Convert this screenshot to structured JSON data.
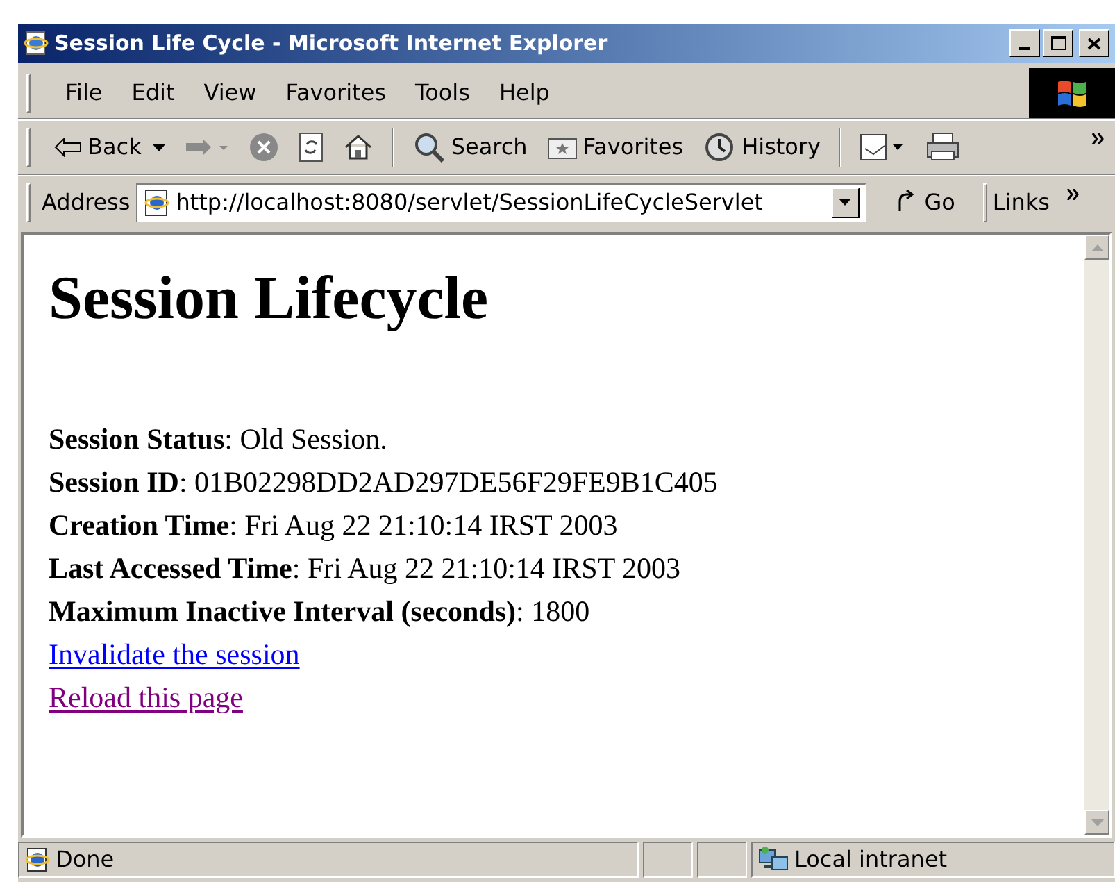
{
  "window": {
    "title": "Session Life Cycle - Microsoft Internet Explorer"
  },
  "menu": [
    "File",
    "Edit",
    "View",
    "Favorites",
    "Tools",
    "Help"
  ],
  "toolbar": [
    {
      "kind": "back",
      "label": "Back"
    },
    {
      "kind": "forward"
    },
    {
      "kind": "stop"
    },
    {
      "kind": "refresh"
    },
    {
      "kind": "home"
    },
    {
      "kind": "sep"
    },
    {
      "kind": "search",
      "label": "Search"
    },
    {
      "kind": "favorites",
      "label": "Favorites"
    },
    {
      "kind": "history",
      "label": "History"
    },
    {
      "kind": "sep"
    },
    {
      "kind": "mail"
    },
    {
      "kind": "print"
    }
  ],
  "address": {
    "label": "Address",
    "value": "http://localhost:8080/servlet/SessionLifeCycleServlet",
    "go": "Go",
    "links": "Links"
  },
  "page": {
    "heading": "Session Lifecycle",
    "fields": [
      {
        "label": "Session Status",
        "value": ": Old Session."
      },
      {
        "label": "Session ID",
        "value": ": 01B02298DD2AD297DE56F29FE9B1C405"
      },
      {
        "label": "Creation Time",
        "value": ": Fri Aug 22 21:10:14 IRST 2003"
      },
      {
        "label": "Last Accessed Time",
        "value": ": Fri Aug 22 21:10:14 IRST 2003"
      },
      {
        "label": "Maximum Inactive Interval (seconds)",
        "value": ": 1800"
      }
    ],
    "links": [
      {
        "text": "Invalidate the session",
        "visited": false
      },
      {
        "text": "Reload this page",
        "visited": true
      }
    ]
  },
  "status_bar": {
    "text": "Done",
    "zone": "Local intranet"
  }
}
